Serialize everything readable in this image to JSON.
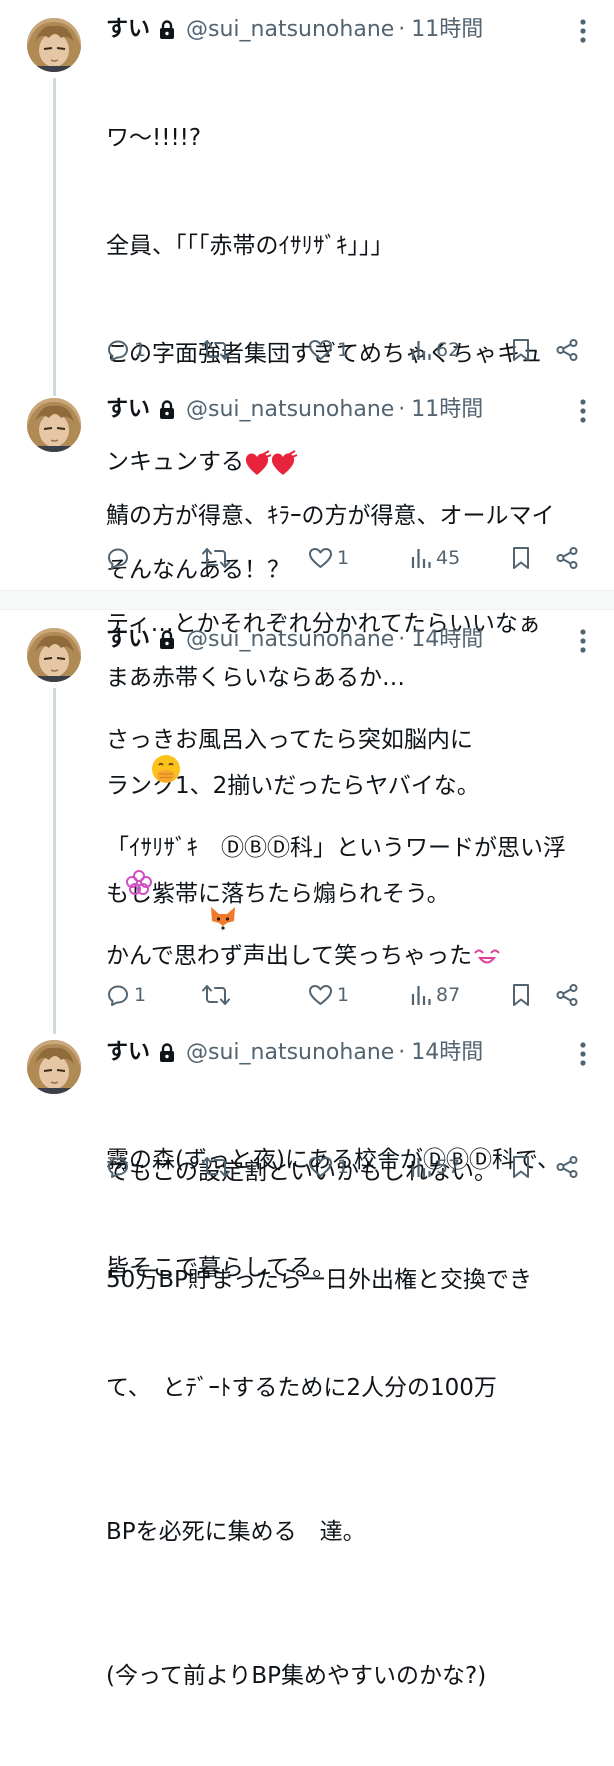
{
  "colors": {
    "text": "#0f1419",
    "muted": "#536471",
    "thread_line": "#cfd9de",
    "divider": "#eff3f4"
  },
  "tweets": [
    {
      "name": "すい",
      "handle": "@sui_natsunohane",
      "separator": "·",
      "time": "11時間",
      "lines": [
        "ワ〜!!!!?",
        "全員、「「「赤帯のｲｻﾘｻﾞｷ」」」",
        "この字面強者集団すぎてめちゃくちゃキュ",
        "ンキュンする",
        "そんなんある！？",
        "まあ赤帯くらいならあるか…",
        "ランク1、2揃いだったらヤバイな。",
        "もし紫帯に落ちたら煽られそう。"
      ],
      "replies": "1",
      "retweets": "",
      "likes": "1",
      "views": "62"
    },
    {
      "name": "すい",
      "handle": "@sui_natsunohane",
      "separator": "·",
      "time": "11時間",
      "lines": [
        "鯖の方が得意、ｷﾗｰの方が得意、オールマイ",
        "ティ…とかそれぞれ分かれてたらいいなぁ"
      ],
      "replies": "",
      "retweets": "",
      "likes": "1",
      "views": "45"
    },
    {
      "name": "すい",
      "handle": "@sui_natsunohane",
      "separator": "·",
      "time": "14時間",
      "lines": [
        "さっきお風呂入ってたら突如脳内に",
        "「ｲｻﾘｻﾞｷ　ⒹⒷⒹ科」というワードが思い浮",
        "かんで思わず声出して笑っちゃった",
        "",
        "でもこの設定割といいかもしれない。",
        "50万BP貯まったら一日外出権と交換でき",
        "て、　とﾃﾞｰﾄするために2人分の100万",
        "BPを必死に集める　達。",
        "(今って前よりBP集めやすいのかな?)"
      ],
      "replies": "1",
      "retweets": "",
      "likes": "1",
      "views": "87"
    },
    {
      "name": "すい",
      "handle": "@sui_natsunohane",
      "separator": "·",
      "time": "14時間",
      "lines": [
        "霧の森(ずっと夜)にある校舎がⒹⒷⒹ科で、",
        "皆そこで暮らしてる。"
      ],
      "replies": "",
      "retweets": "",
      "likes": "1",
      "views": "57"
    }
  ]
}
